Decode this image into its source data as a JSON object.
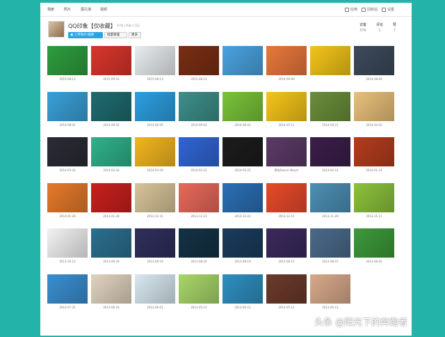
{
  "nav": {
    "tabs": [
      "相册",
      "照片",
      "展孔墙",
      "视频"
    ],
    "tools": [
      "应用",
      "回收站",
      "设置"
    ]
  },
  "album": {
    "title": "QQ印象【仅收藏】",
    "count": "47张",
    "owner_note": "所有人可见",
    "upload_label": "上传照片/视频",
    "batch_label": "批量管理",
    "more_label": "更多"
  },
  "stats": [
    {
      "label": "访客",
      "value": "376"
    },
    {
      "label": "评论",
      "value": "1"
    },
    {
      "label": "赞",
      "value": "7"
    }
  ],
  "colors": {
    "page_background": "#24b3a9",
    "upload_button": "#2ea2e0"
  },
  "photos": [
    {
      "date": "2015-08-11",
      "color": "#2e9e3e"
    },
    {
      "date": "2015-09-03",
      "color": "#d9352b"
    },
    {
      "date": "2015-08-13",
      "color": "#e8ecef"
    },
    {
      "date": "2015-08-13",
      "color": "#7a2e14"
    },
    {
      "date": "",
      "color": "#4aa3e0"
    },
    {
      "date": "2014-09-09",
      "color": "#e8783c"
    },
    {
      "date": "",
      "color": "#f2c419"
    },
    {
      "date": "2014-08-04",
      "color": "#3d4a5c"
    },
    {
      "date": "2014-08-02",
      "color": "#3aa0d8"
    },
    {
      "date": "2014-08-02",
      "color": "#1f6b6f"
    },
    {
      "date": "2014-06-06",
      "color": "#2d9fe0"
    },
    {
      "date": "2014-06-01",
      "color": "#3d8f8a"
    },
    {
      "date": "2014-06-01",
      "color": "#79c43a"
    },
    {
      "date": "2014-05-11",
      "color": "#f5c518"
    },
    {
      "date": "2014-04-21",
      "color": "#6a8f3a"
    },
    {
      "date": "2014-04-20",
      "color": "#e8c079"
    },
    {
      "date": "2014-03-30",
      "color": "#2b2b35"
    },
    {
      "date": "2014-03-30",
      "color": "#2fb28a"
    },
    {
      "date": "2014-03-29",
      "color": "#f2b61f"
    },
    {
      "date": "2014-03-25",
      "color": "#3165d4"
    },
    {
      "date": "2014-03-25",
      "color": "#1c1c1c"
    },
    {
      "date": "赞啦Qzone Album",
      "color": "#5b3a66"
    },
    {
      "date": "2014-02-14",
      "color": "#3b1e4a"
    },
    {
      "date": "2014-01-31",
      "color": "#b43c1e"
    },
    {
      "date": "2014-01-28",
      "color": "#e57a2b"
    },
    {
      "date": "2014-01-28",
      "color": "#c9201c"
    },
    {
      "date": "2013-12-31",
      "color": "#d8c49a"
    },
    {
      "date": "2013-12-23",
      "color": "#e8695a"
    },
    {
      "date": "2013-12-22",
      "color": "#2b6fb5"
    },
    {
      "date": "2013-12-15",
      "color": "#e84a2b"
    },
    {
      "date": "2013-11-28",
      "color": "#4d8fb5"
    },
    {
      "date": "2013-11-11",
      "color": "#8cc23c"
    },
    {
      "date": "2013-10-13",
      "color": "#f2f2f2"
    },
    {
      "date": "2013-09-29",
      "color": "#2b6f8f"
    },
    {
      "date": "2013-09-19",
      "color": "#2f2f5c"
    },
    {
      "date": "2013-08-20",
      "color": "#143245"
    },
    {
      "date": "2013-08-19",
      "color": "#1a3c5c"
    },
    {
      "date": "2013-08-15",
      "color": "#3a2a5c"
    },
    {
      "date": "2013-08-07",
      "color": "#4a6a8a"
    },
    {
      "date": "2013-06-02",
      "color": "#3c9a3a"
    },
    {
      "date": "2013-07-31",
      "color": "#3a8fd0"
    },
    {
      "date": "2013-06-16",
      "color": "#e0d3bf"
    },
    {
      "date": "2013-06-01",
      "color": "#d8e8f0"
    },
    {
      "date": "2013-05-12",
      "color": "#a9d66a"
    },
    {
      "date": "2013-05-12",
      "color": "#2f8fc0"
    },
    {
      "date": "2013-05-12",
      "color": "#6b3a2a"
    },
    {
      "date": "2013-05-12",
      "color": "#d8a98a"
    }
  ],
  "watermark": "头条 @阳光下的奔跑者"
}
